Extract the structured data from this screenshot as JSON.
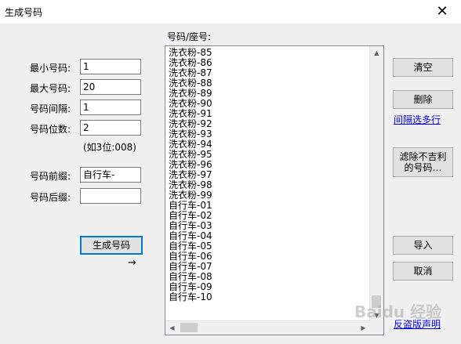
{
  "window": {
    "title": "生成号码",
    "close_glyph": "✕"
  },
  "form": {
    "min_label": "最小号码:",
    "min_value": "1",
    "max_label": "最大号码:",
    "max_value": "20",
    "interval_label": "号码间隔:",
    "interval_value": "1",
    "digits_label": "号码位数:",
    "digits_value": "2",
    "digits_hint": "(如3位:008)",
    "prefix_label": "号码前缀:",
    "prefix_value": "自行车-",
    "suffix_label": "号码后缀:",
    "suffix_value": "",
    "generate_label": "生成号码",
    "arrow_glyph": "→"
  },
  "list": {
    "header": "号码/座号:",
    "items": [
      "洗衣粉-85",
      "洗衣粉-86",
      "洗衣粉-87",
      "洗衣粉-88",
      "洗衣粉-89",
      "洗衣粉-90",
      "洗衣粉-91",
      "洗衣粉-92",
      "洗衣粉-93",
      "洗衣粉-94",
      "洗衣粉-95",
      "洗衣粉-96",
      "洗衣粉-97",
      "洗衣粉-98",
      "洗衣粉-99",
      "自行车-01",
      "自行车-02",
      "自行车-03",
      "自行车-04",
      "自行车-05",
      "自行车-06",
      "自行车-07",
      "自行车-08",
      "自行车-09",
      "自行车-10"
    ]
  },
  "actions": {
    "clear_label": "清空",
    "delete_label": "删除",
    "interval_select_link": "间隔选多行",
    "filter_label": "滤除不吉利\n的号码…",
    "import_label": "导入",
    "cancel_label": "取消",
    "antipiracy_link": "反盗版声明"
  },
  "watermark": {
    "text": "Baidu 经验"
  },
  "colors": {
    "link": "#0000ee",
    "default_border": "#0078d7"
  }
}
